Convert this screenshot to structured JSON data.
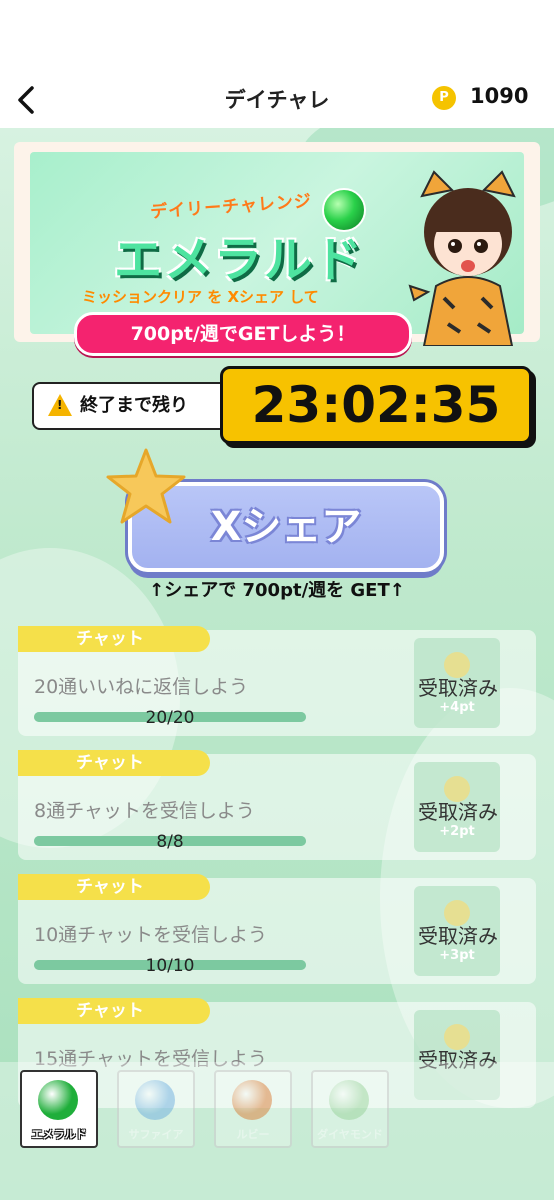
{
  "header": {
    "back_label": "‹",
    "title": "デイチャレ",
    "coin_symbol": "P",
    "points": "1090"
  },
  "banner": {
    "subtitle": "デイリーチャレンジ",
    "headline": "エメラルド",
    "mission_line": "ミッションクリア を Xシェア して",
    "reward_line": "700pt/週でGETしよう！"
  },
  "timer": {
    "label": "終了まで残り",
    "remaining": "23:02:35"
  },
  "share": {
    "button_label": "Xシェア",
    "caption": "↑シェアで 700pt/週を GET↑"
  },
  "missions": [
    {
      "tag": "チャット",
      "text": "20通いいねに返信しよう",
      "progress": "20/20",
      "fraction": 1.0,
      "reward": "+4pt",
      "status": "受取済み"
    },
    {
      "tag": "チャット",
      "text": "8通チャットを受信しよう",
      "progress": "8/8",
      "fraction": 1.0,
      "reward": "+2pt",
      "status": "受取済み"
    },
    {
      "tag": "チャット",
      "text": "10通チャットを受信しよう",
      "progress": "10/10",
      "fraction": 1.0,
      "reward": "+3pt",
      "status": "受取済み"
    },
    {
      "tag": "チャット",
      "text": "15通チャットを受信しよう",
      "progress": "",
      "fraction": 1.0,
      "reward": "",
      "status": "受取済み"
    }
  ],
  "tabs": [
    {
      "label": "エメラルド",
      "icon": "emerald-gem-icon",
      "color": "#1fae3a",
      "active": true
    },
    {
      "label": "サファイア",
      "icon": "sapphire-gem-icon",
      "color": "#7fb8e6",
      "active": false
    },
    {
      "label": "ルビー",
      "icon": "ruby-gem-icon",
      "color": "#e2894a",
      "active": false
    },
    {
      "label": "ダイヤモンド",
      "icon": "diamond-gem-icon",
      "color": "#a8d9a8",
      "active": false
    }
  ],
  "colors": {
    "accent_yellow": "#f7c200",
    "share_button": "#a3b2f0",
    "pill_pink": "#f4236f",
    "tag_yellow": "#f5e04a"
  }
}
